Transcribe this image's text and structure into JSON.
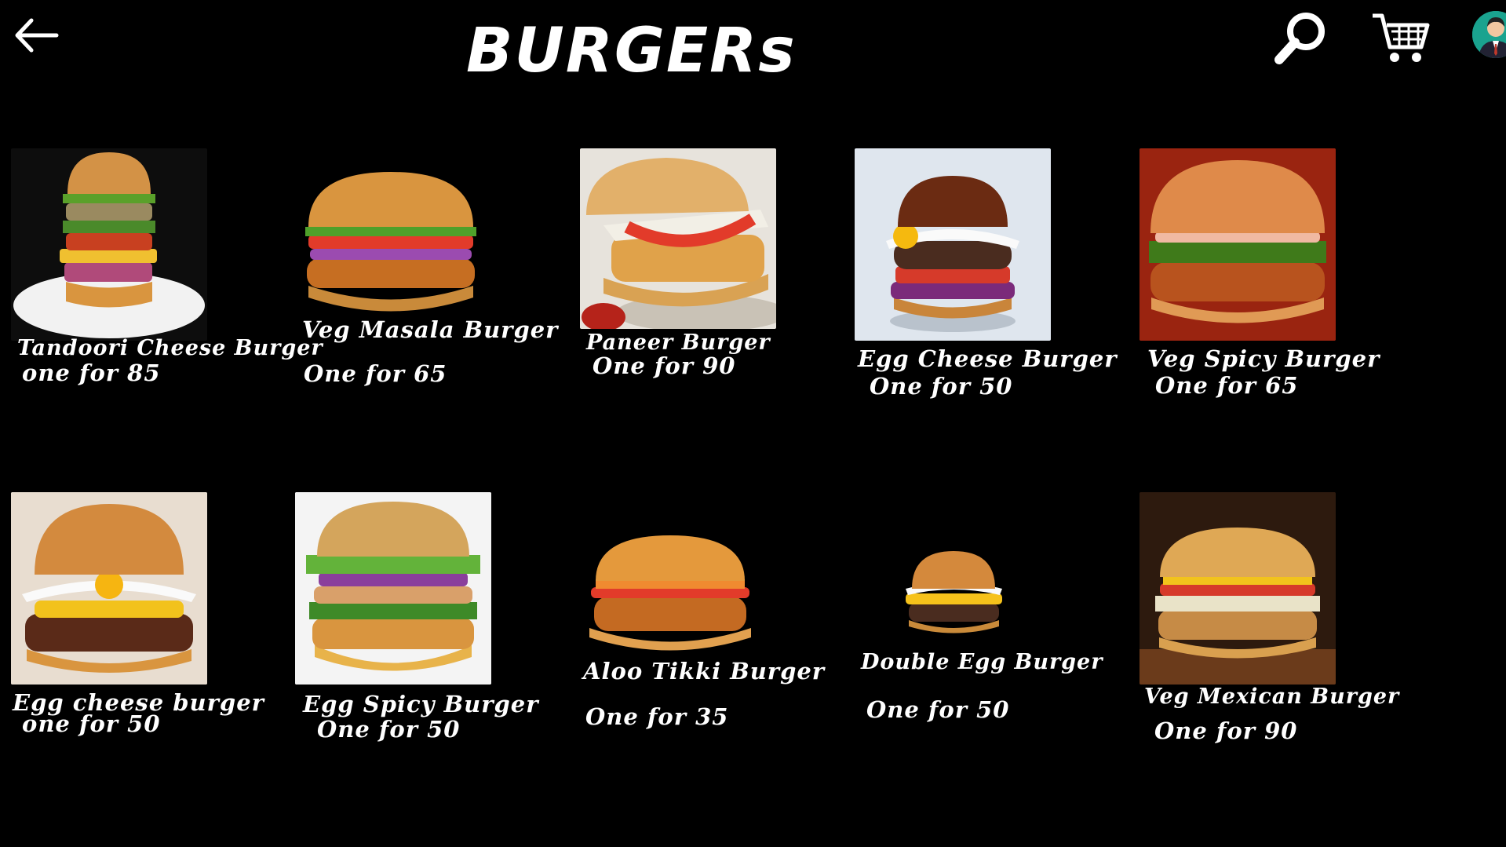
{
  "header": {
    "title": "BURGERs",
    "back_icon": "arrow-left-icon",
    "search_icon": "search-icon",
    "cart_icon": "cart-icon",
    "avatar_icon": "user-avatar-icon"
  },
  "products": [
    {
      "name": "Tandoori Cheese Burger",
      "price": "one for 85"
    },
    {
      "name": "Veg Masala Burger",
      "price": "One for 65"
    },
    {
      "name": "Paneer Burger",
      "price": "One for 90"
    },
    {
      "name": "Egg Cheese Burger",
      "price": "One for 50"
    },
    {
      "name": "Veg Spicy Burger",
      "price": "One for 65"
    },
    {
      "name": "Egg cheese burger",
      "price": "one for 50"
    },
    {
      "name": "Egg Spicy Burger",
      "price": "One for 50"
    },
    {
      "name": "Aloo Tikki Burger",
      "price": "One for 35"
    },
    {
      "name": "Double Egg Burger",
      "price": "One for 50"
    },
    {
      "name": "Veg Mexican Burger",
      "price": "One for 90"
    }
  ],
  "colors": {
    "background": "#000000",
    "text": "#ffffff",
    "bun": "#d9953f",
    "avatar": "#1aa38f"
  }
}
